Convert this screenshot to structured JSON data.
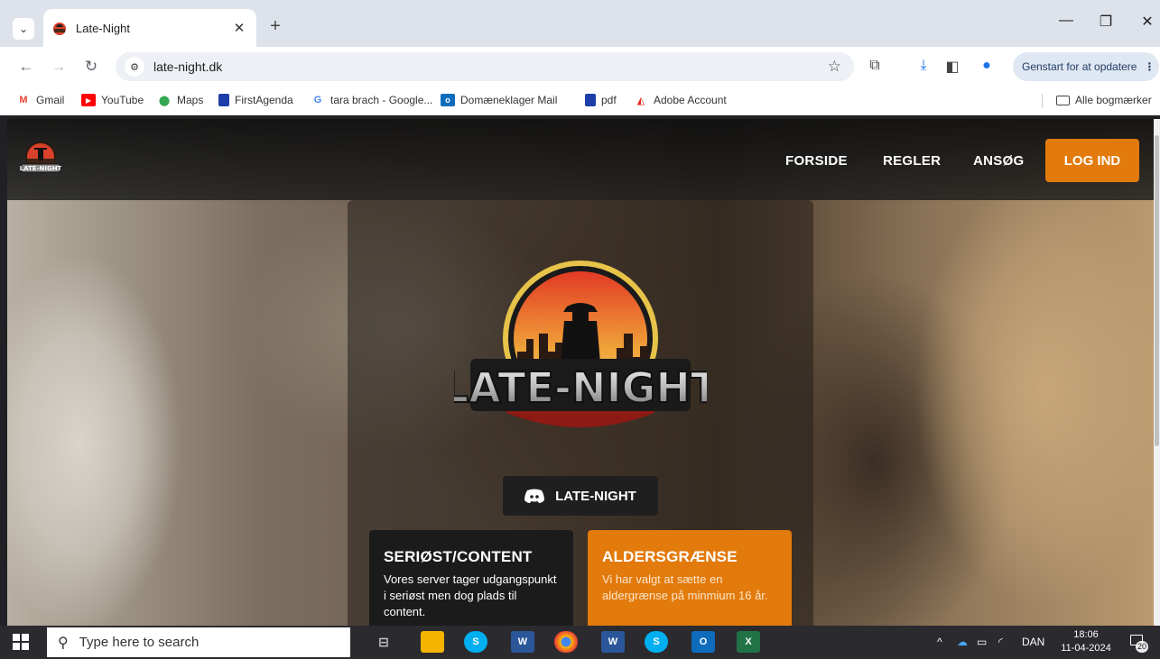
{
  "browser": {
    "tab_title": "Late-Night",
    "url": "late-night.dk",
    "restart_label": "Genstart for at opdatere",
    "bookmarks": [
      {
        "label": "Gmail",
        "icon": "gmail-icon",
        "color": "#ea4335"
      },
      {
        "label": "YouTube",
        "icon": "youtube-icon",
        "color": "#ff0000"
      },
      {
        "label": "Maps",
        "icon": "maps-icon",
        "color": "#34a853"
      },
      {
        "label": "FirstAgenda",
        "icon": "firstagenda-icon",
        "color": "#1d3ea8"
      },
      {
        "label": "tara brach - Google...",
        "icon": "google-icon",
        "color": "#4285f4"
      },
      {
        "label": "Domæneklager Mail",
        "icon": "outlook-icon",
        "color": "#0f6cbd"
      },
      {
        "label": "pdf",
        "icon": "pdf-icon",
        "color": "#1d3ea8"
      },
      {
        "label": "Adobe Account",
        "icon": "adobe-icon",
        "color": "#e1251b"
      }
    ],
    "all_bookmarks": "Alle bogmærker"
  },
  "site": {
    "nav": [
      "FORSIDE",
      "REGLER",
      "ANSØG"
    ],
    "login_label": "LOG IND",
    "logo_text": "LATE-NIGHT",
    "discord_label": "LATE-NIGHT",
    "cards": [
      {
        "title": "SERIØST/CONTENT",
        "text": "Vores server tager udgangspunkt i seriøst men dog plads til content."
      },
      {
        "title": "ALDERSGRÆNSE",
        "text": "Vi har valgt at sætte en aldergrænse på minmium 16 år."
      }
    ],
    "accent": "#e27a0c"
  },
  "taskbar": {
    "search_placeholder": "Type here to search",
    "lang": "DAN",
    "time": "18:06",
    "date": "11-04-2024",
    "notifications": "20"
  }
}
